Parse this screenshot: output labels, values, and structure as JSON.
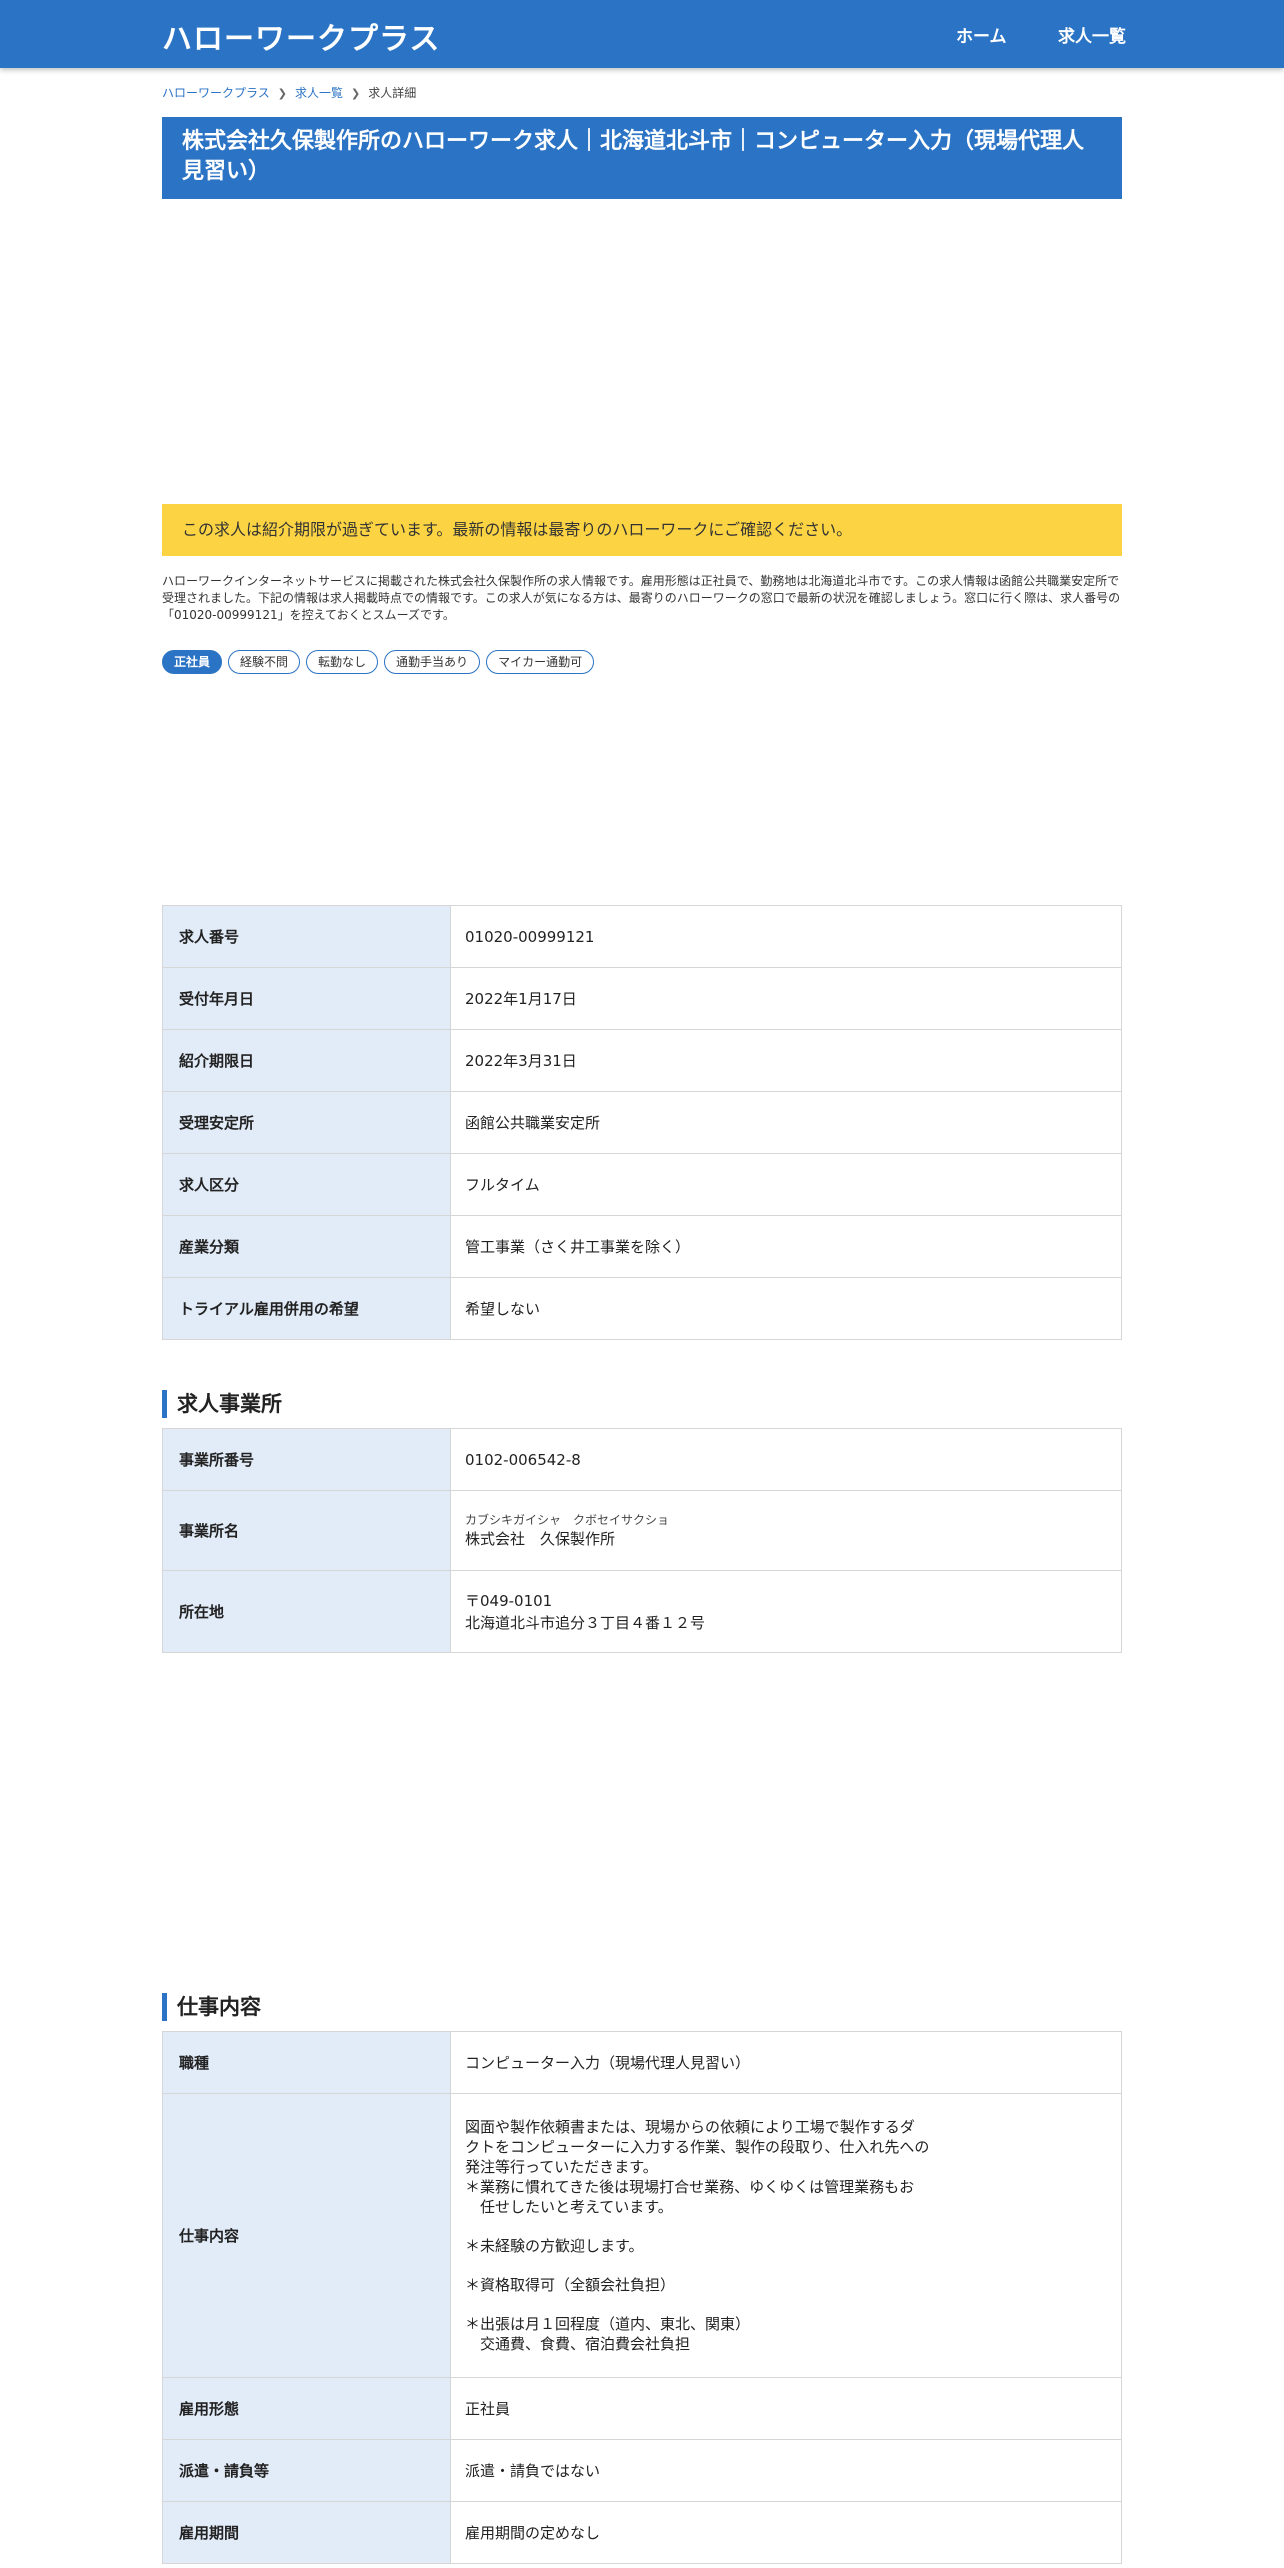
{
  "header": {
    "brand": "ハローワークプラス",
    "nav": [
      "ホーム",
      "求人一覧"
    ]
  },
  "breadcrumb": {
    "items": [
      "ハローワークプラス",
      "求人一覧",
      "求人詳細"
    ]
  },
  "title": "株式会社久保製作所のハローワーク求人｜北海道北斗市｜コンピューター入力（現場代理人見習い）",
  "notice": "この求人は紹介期限が過ぎています。最新の情報は最寄りのハローワークにご確認ください。",
  "intro": "ハローワークインターネットサービスに掲載された株式会社久保製作所の求人情報です。雇用形態は正社員で、勤務地は北海道北斗市です。この求人情報は函館公共職業安定所で受理されました。下記の情報は求人掲載時点での情報です。この求人が気になる方は、最寄りのハローワークの窓口で最新の状況を確認しましょう。窓口に行く際は、求人番号の「01020-00999121」を控えておくとスムーズです。",
  "tags": [
    "正社員",
    "経験不問",
    "転勤なし",
    "通勤手当あり",
    "マイカー通勤可"
  ],
  "basic_table": [
    {
      "label": "求人番号",
      "value": "01020-00999121"
    },
    {
      "label": "受付年月日",
      "value": "2022年1月17日"
    },
    {
      "label": "紹介期限日",
      "value": "2022年3月31日"
    },
    {
      "label": "受理安定所",
      "value": "函館公共職業安定所"
    },
    {
      "label": "求人区分",
      "value": "フルタイム"
    },
    {
      "label": "産業分類",
      "value": "管工事業（さく井工事業を除く）"
    },
    {
      "label": "トライアル雇用併用の希望",
      "value": "希望しない"
    }
  ],
  "office_section": {
    "heading": "求人事業所",
    "office_number_label": "事業所番号",
    "office_number": "0102-006542-8",
    "office_name_label": "事業所名",
    "office_name_kana": "カブシキガイシャ　クボセイサクショ",
    "office_name": "株式会社　久保製作所",
    "address_label": "所在地",
    "postal": "〒049-0101",
    "address": "北海道北斗市追分３丁目４番１２号"
  },
  "work_section": {
    "heading": "仕事内容",
    "occupation_label": "職種",
    "occupation": "コンピューター入力（現場代理人見習い）",
    "description_label": "仕事内容",
    "description": [
      "図面や製作依頼書または、現場からの依頼により工場で製作するダ\nクトをコンピューターに入力する作業、製作の段取り、仕入れ先への\n発注等行っていただきます。\n＊業務に慣れてきた後は現場打合せ業務、ゆくゆくは管理業務もお\n　任せしたいと考えています。",
      "＊未経験の方歓迎します。",
      "＊資格取得可（全額会社負担）",
      "＊出張は月１回程度（道内、東北、関東）\n　交通費、食費、宿泊費会社負担"
    ],
    "employment_type_label": "雇用形態",
    "employment_type": "正社員",
    "dispatch_label": "派遣・請負等",
    "dispatch": "派遣・請負ではない",
    "period_label": "雇用期間",
    "period": "雇用期間の定めなし"
  }
}
